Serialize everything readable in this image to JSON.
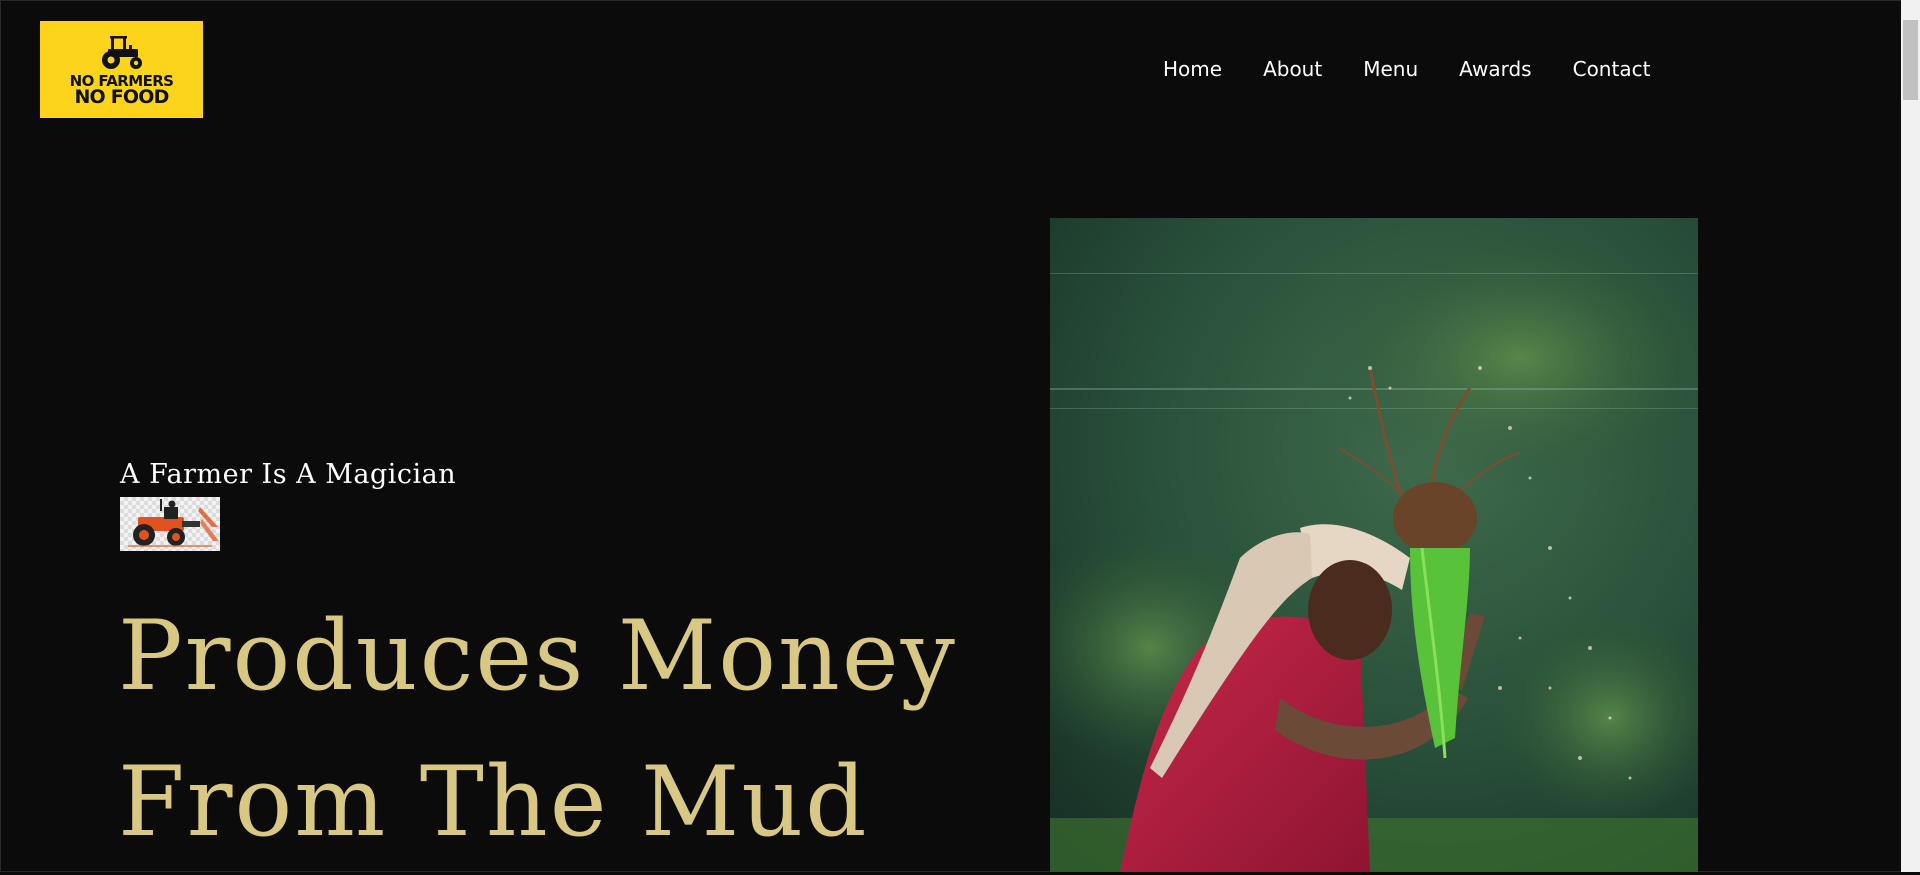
{
  "brand": {
    "logo_line1": "NO FARMERS",
    "logo_line2": "NO FOOD",
    "logo_bg": "#fdd41c",
    "logo_icon": "tractor-icon"
  },
  "nav": {
    "items": [
      {
        "label": "Home"
      },
      {
        "label": "About"
      },
      {
        "label": "Menu"
      },
      {
        "label": "Awards"
      },
      {
        "label": "Contact"
      }
    ]
  },
  "hero": {
    "kicker": "A Farmer Is A Magician",
    "headline_line1": "Produces Money",
    "headline_line2": "From The Mud",
    "headline_color": "#d9c784",
    "kicker_image": "tractor-illustration",
    "photo": "farmer-planting-rice-seedlings"
  },
  "theme": {
    "background": "#0b0b0b",
    "text": "#ffffff"
  }
}
